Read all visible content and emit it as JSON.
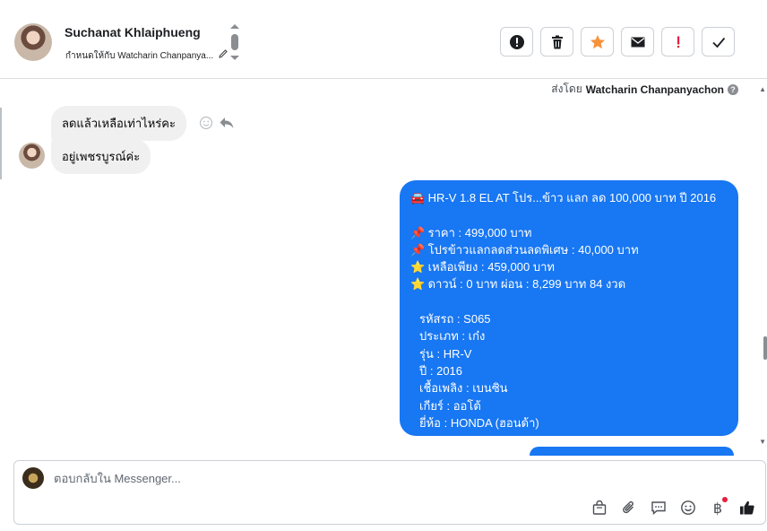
{
  "contact": {
    "name": "Suchanat Khlaiphueng",
    "assigned_label": "กำหนดให้กับ Watcharin Chanpanya..."
  },
  "header_actions": [
    {
      "icon": "exclamation-circle-icon"
    },
    {
      "icon": "trash-icon"
    },
    {
      "icon": "star-icon",
      "color": "#f7923b"
    },
    {
      "icon": "envelope-icon"
    },
    {
      "icon": "exclamation-icon",
      "color": "#e41e3f"
    },
    {
      "icon": "checkmark-icon"
    }
  ],
  "sent_by": {
    "prefix": "ส่งโดย",
    "name": "Watcharin Chanpanyachon"
  },
  "incoming_messages": [
    {
      "text": "ลดแล้วเหลือเท่าไหร่คะ"
    },
    {
      "text": "อยู่เพชรบูรณ์ค่ะ"
    }
  ],
  "outgoing_message": {
    "title": {
      "emoji": "🚘",
      "text": "HR-V 1.8 EL AT โปร...ข้าว แลก ลด 100,000 บาท ปี 2016"
    },
    "price_lines": [
      {
        "emoji": "📌",
        "text": "ราคา : 499,000 บาท"
      },
      {
        "emoji": "📌",
        "text": "โปรข้าวแลกลดส่วนลดพิเศษ : 40,000 บาท"
      },
      {
        "emoji": "⭐",
        "text": "เหลือเพียง : 459,000 บาท"
      },
      {
        "emoji": "⭐",
        "text": "ดาวน์ : 0 บาท ผ่อน : 8,299 บาท 84 งวด"
      }
    ],
    "spec_lines": [
      "รหัสรถ : S065",
      "ประเภท : เก๋ง",
      "รุ่น : HR-V",
      "ปี : 2016",
      "เชื้อเพลิง : เบนซิน",
      "เกียร์ : ออโต้",
      "ยี่ห้อ : HONDA (ฮอนด้า)"
    ],
    "bubble_color": "#1877f2"
  },
  "composer": {
    "placeholder": "ตอบกลับใน Messenger...",
    "tools": [
      "shopping-bag-icon",
      "paperclip-icon",
      "saved-reply-icon",
      "emoji-icon",
      "baht-icon",
      "thumbs-up-icon"
    ],
    "baht_symbol": "฿"
  }
}
